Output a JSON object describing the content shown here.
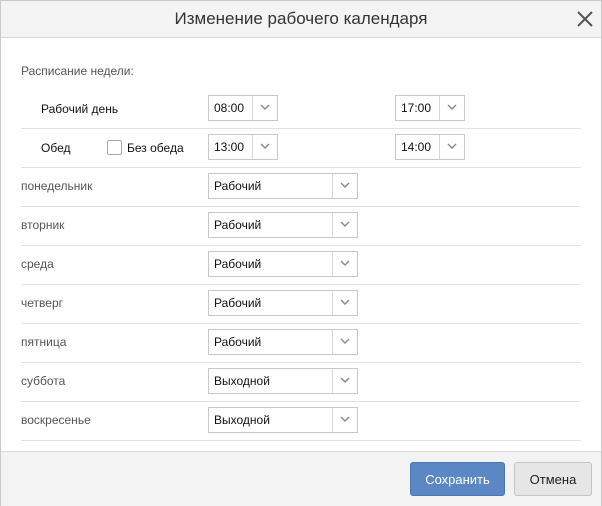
{
  "dialog": {
    "title": "Изменение рабочего календаря",
    "close_icon": "close-icon"
  },
  "schedule": {
    "section_label": "Расписание недели:",
    "workday": {
      "label": "Рабочий день",
      "start": "08:00",
      "end": "17:00"
    },
    "lunch": {
      "label": "Обед",
      "no_lunch_label": "Без обеда",
      "no_lunch_checked": false,
      "start": "13:00",
      "end": "14:00"
    }
  },
  "days": [
    {
      "name": "понедельник",
      "value": "Рабочий"
    },
    {
      "name": "вторник",
      "value": "Рабочий"
    },
    {
      "name": "среда",
      "value": "Рабочий"
    },
    {
      "name": "четверг",
      "value": "Рабочий"
    },
    {
      "name": "пятница",
      "value": "Рабочий"
    },
    {
      "name": "суббота",
      "value": "Выходной"
    },
    {
      "name": "воскресенье",
      "value": "Выходной"
    }
  ],
  "footer": {
    "save_label": "Сохранить",
    "cancel_label": "Отмена"
  },
  "colors": {
    "primary": "#5b87c4",
    "border": "#c8c8c8"
  }
}
